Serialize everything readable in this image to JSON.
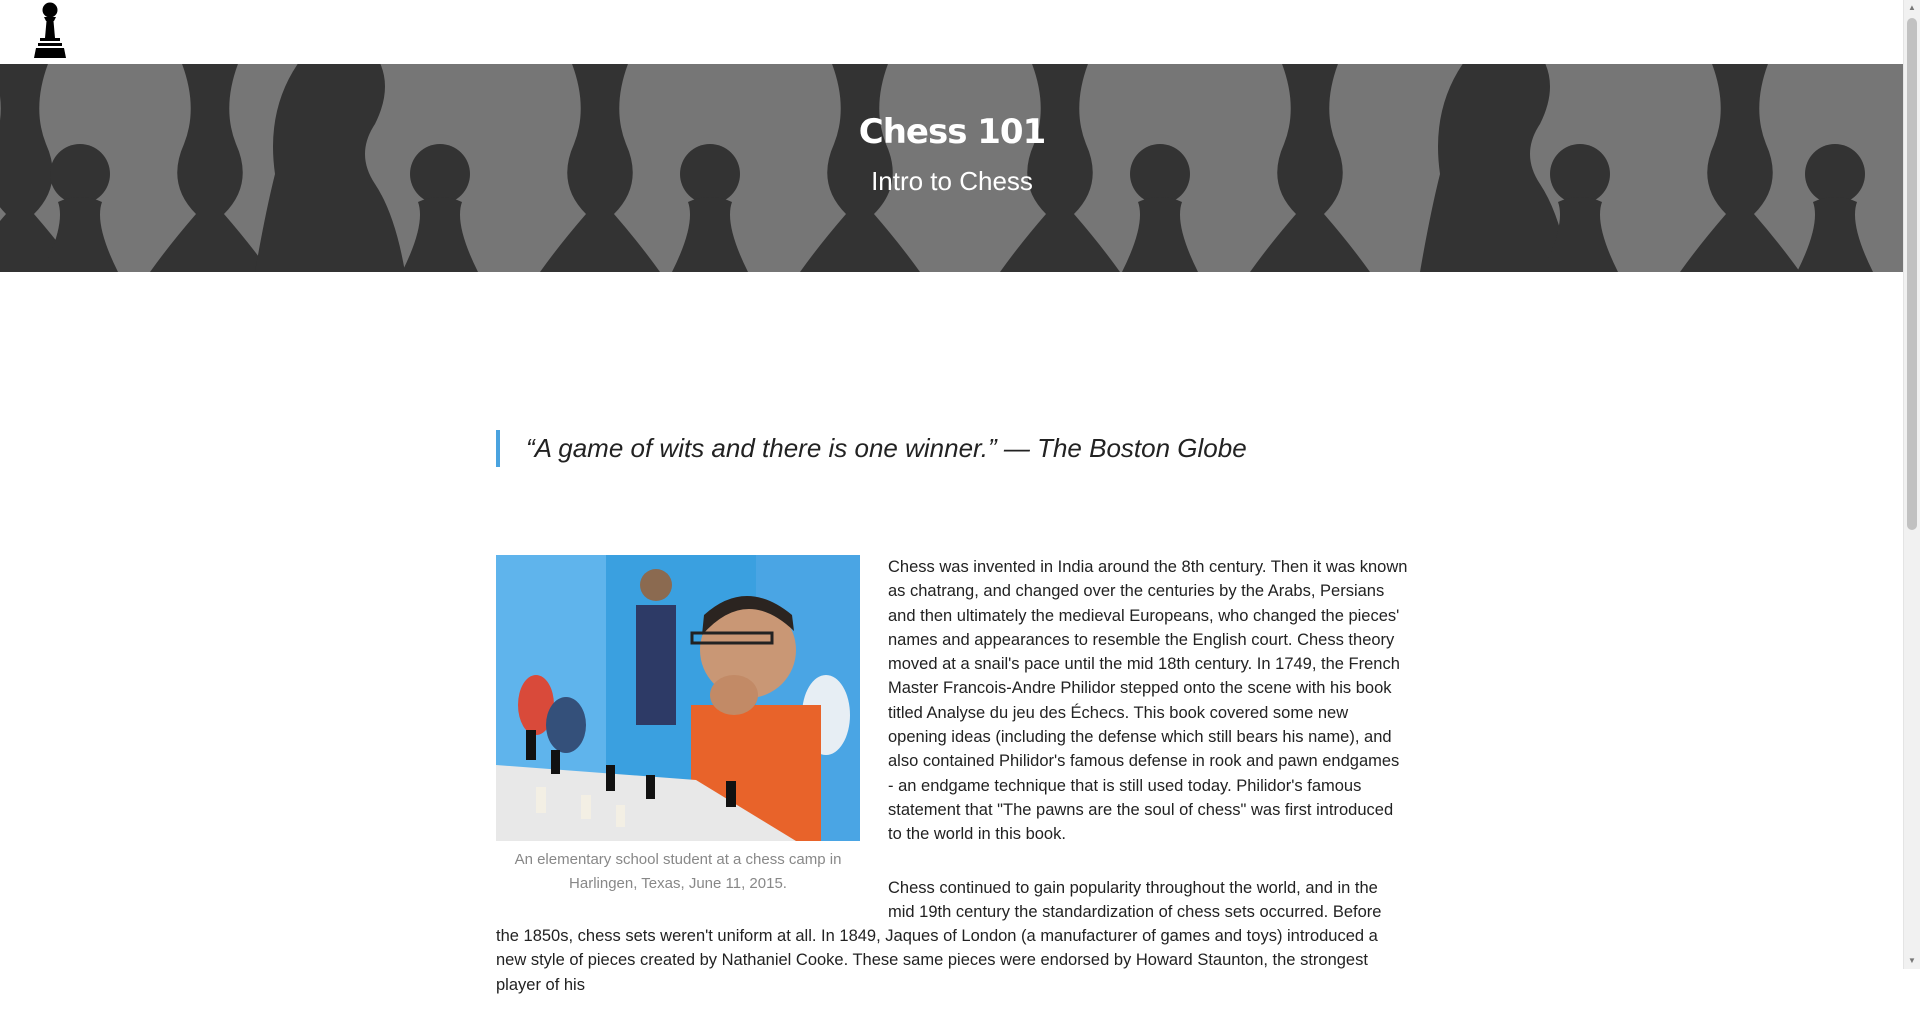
{
  "header": {
    "logo_icon": "chess-pawn-icon"
  },
  "hero": {
    "title": "Chess 101",
    "subtitle": "Intro to Chess",
    "background_icon": "chess-pieces-silhouette"
  },
  "quote": {
    "text": "“A game of wits and there is one winner.” — The Boston Globe",
    "accent_color": "#4aa3df"
  },
  "article": {
    "figure": {
      "image": "student-at-chess-camp-photo",
      "caption": "An elementary school student at a chess camp in Harlingen, Texas, June 11, 2015."
    },
    "paragraphs": [
      "Chess was invented in India around the 8th century. Then it was known as chatrang, and changed over the centuries by the Arabs, Persians and then ultimately the medieval Europeans, who changed the pieces' names and appearances to resemble the English court. Chess theory moved at a snail's pace until the mid 18th century. In 1749, the French Master Francois-Andre Philidor stepped onto the scene with his book titled Analyse du jeu des Échecs. This book covered some new opening ideas (including the defense which still bears his name), and also contained Philidor's famous defense in rook and pawn endgames - an endgame technique that is still used today. Philidor's famous statement that \"The pawns are the soul of chess\" was first introduced to the world in this book.",
      "Chess continued to gain popularity throughout the world, and in the mid 19th century the standardization of chess sets occurred. Before the 1850s, chess sets weren't uniform at all. In 1849, Jaques of London (a manufacturer of games and toys) introduced a new style of pieces created by Nathaniel Cooke. These same pieces were endorsed by Howard Staunton, the strongest player of his"
    ]
  }
}
